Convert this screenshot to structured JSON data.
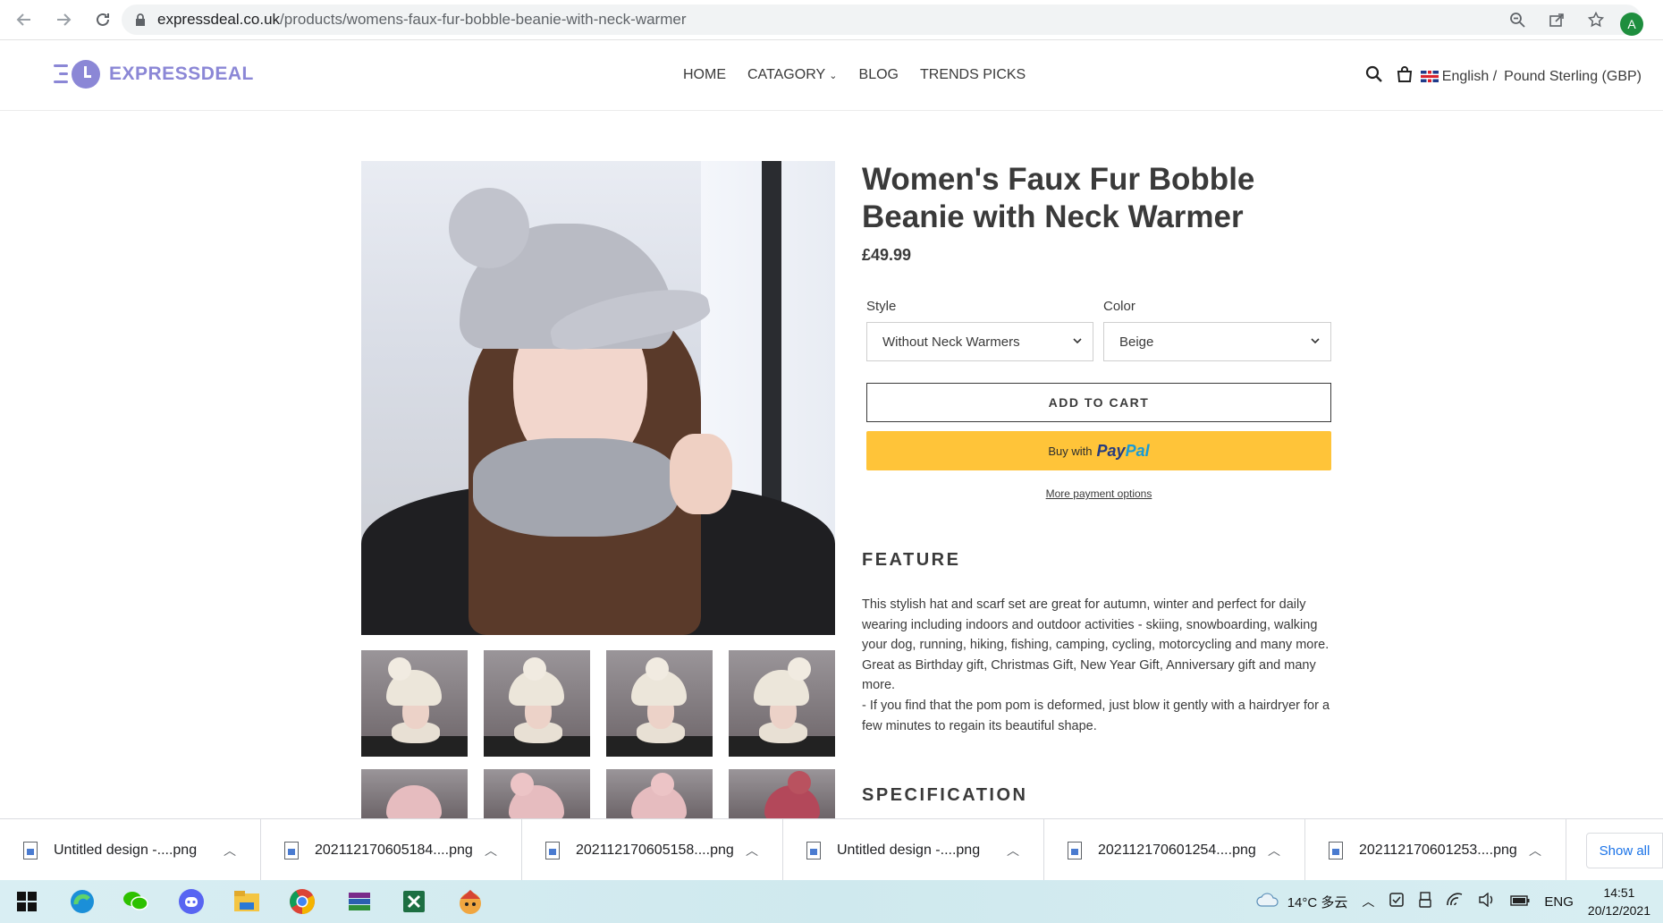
{
  "browser": {
    "url_host": "expressdeal.co.uk",
    "url_path": "/products/womens-faux-fur-bobble-beanie-with-neck-warmer",
    "profile_initial": "A"
  },
  "header": {
    "logo_text": "EXPRESSDEAL",
    "nav": [
      "HOME",
      "CATAGORY",
      "BLOG",
      "TRENDS PICKS"
    ],
    "language": "English /",
    "currency": "Pound Sterling (GBP)"
  },
  "product": {
    "title": "Women's Faux Fur Bobble Beanie with Neck Warmer",
    "price": "£49.99",
    "style_label": "Style",
    "style_value": "Without Neck Warmers",
    "color_label": "Color",
    "color_value": "Beige",
    "add_to_cart": "ADD TO CART",
    "paypal_prefix": "Buy with",
    "paypal_brand_1": "Pay",
    "paypal_brand_2": "Pal",
    "more_payment": "More payment options",
    "feature_heading": "FEATURE",
    "description_1": "This stylish hat and scarf set are great for autumn, winter and perfect for daily wearing including indoors and outdoor activities - skiing, snowboarding, walking your dog, running, hiking, fishing, camping, cycling, motorcycling and many more. Great as Birthday gift, Christmas Gift, New Year Gift, Anniversary gift and many more.",
    "description_2": "- If you find that the pom pom is deformed, just blow it gently with a hairdryer for a few minutes to regain its beautiful shape.",
    "spec_heading": "SPECIFICATION"
  },
  "downloads": {
    "items": [
      "Untitled design -....png",
      "202112170605184....png",
      "202112170605158....png",
      "Untitled design -....png",
      "202112170601254....png",
      "202112170601253....png"
    ],
    "show_all": "Show all"
  },
  "taskbar": {
    "weather": "14°C 多云",
    "lang": "ENG",
    "time": "14:51",
    "date": "20/12/2021"
  },
  "colors": {
    "brand": "#8b87d6",
    "paypal_yellow": "#ffc439",
    "paypal_dark": "#253b80",
    "paypal_light": "#179bd7"
  }
}
